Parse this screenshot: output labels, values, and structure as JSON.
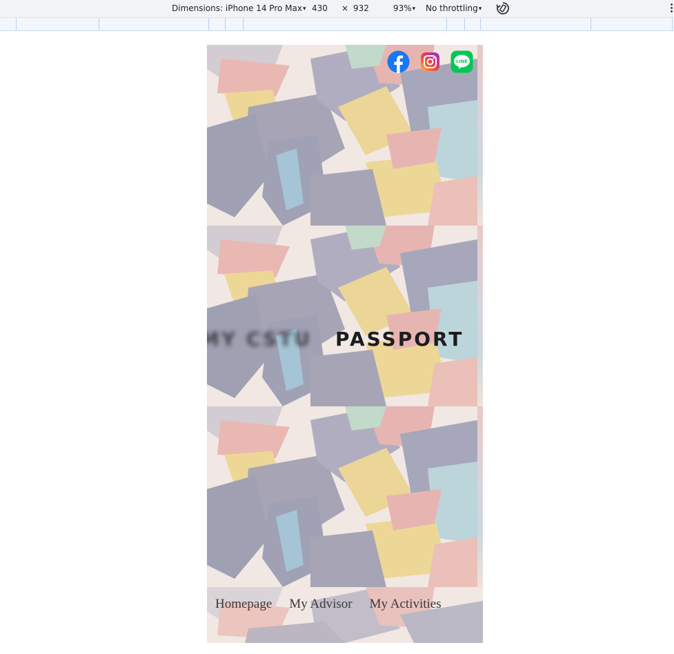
{
  "devtools": {
    "dimensions_label": "Dimensions: iPhone 14 Pro Max",
    "width": "430",
    "times": "×",
    "height": "932",
    "zoom": "93%",
    "throttling": "No throttling",
    "caret": "▾"
  },
  "page": {
    "headline_blurred": "MY CSTU",
    "headline_sharp": "PASSPORT",
    "nav": {
      "items": [
        {
          "label": "Homepage"
        },
        {
          "label": "My Advisor"
        },
        {
          "label": "My Activities"
        }
      ]
    },
    "social": {
      "icons": [
        "facebook-icon",
        "instagram-icon",
        "line-icon"
      ],
      "line_text": "LINE"
    }
  },
  "colors": {
    "facebook": "#1877f2",
    "line": "#06c755",
    "nav_text": "#3a3a3a"
  }
}
